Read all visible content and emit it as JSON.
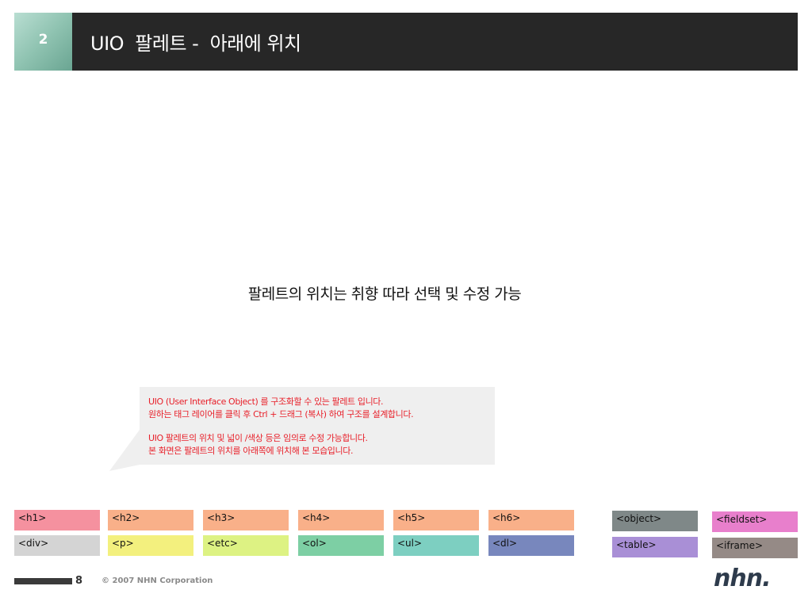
{
  "header": {
    "slide_number": "2",
    "title": "UIO  팔레트 -  아래에 위치"
  },
  "caption": "팔레트의 위치는 취향 따라 선택 및 수정 가능",
  "callout": {
    "line1": "UIO (User Interface Object) 를 구조화할 수 있는 팔레트 입니다.",
    "line2": "원하는 태그 레이어를 클릭 후 Ctrl + 드래그 (복사) 하여 구조를 설계합니다.",
    "line3": "UIO 팔레트의 위치 및 넓이 /색상 등은 임의로 수정 가능합니다.",
    "line4": "본 화면은 팔레트의 위치를 아래쪽에 위치해 본 모습입니다."
  },
  "palette": {
    "h1": {
      "label": "<h1>",
      "color": "#f5919f"
    },
    "h2": {
      "label": "<h2>",
      "color": "#f9b089"
    },
    "h3": {
      "label": "<h3>",
      "color": "#f9b089"
    },
    "h4": {
      "label": "<h4>",
      "color": "#f9b089"
    },
    "h5": {
      "label": "<h5>",
      "color": "#f9b089"
    },
    "h6": {
      "label": "<h6>",
      "color": "#f9b089"
    },
    "div": {
      "label": "<div>",
      "color": "#d4d4d4"
    },
    "p": {
      "label": "<p>",
      "color": "#f3f07e"
    },
    "etc": {
      "label": "<etc>",
      "color": "#ddf283"
    },
    "ol": {
      "label": "<ol>",
      "color": "#7dcfa4"
    },
    "ul": {
      "label": "<ul>",
      "color": "#7dcfc1"
    },
    "dl": {
      "label": "<dl>",
      "color": "#7887bd"
    },
    "object": {
      "label": "<object>",
      "color": "#7f8888"
    },
    "fieldset": {
      "label": "<fieldset>",
      "color": "#e87fcc"
    },
    "table": {
      "label": "<table>",
      "color": "#a98fd6"
    },
    "iframe": {
      "label": "<iframe>",
      "color": "#958a86"
    }
  },
  "footer": {
    "page_number": "8",
    "copyright": "© 2007 NHN Corporation",
    "logo": "nhn."
  }
}
